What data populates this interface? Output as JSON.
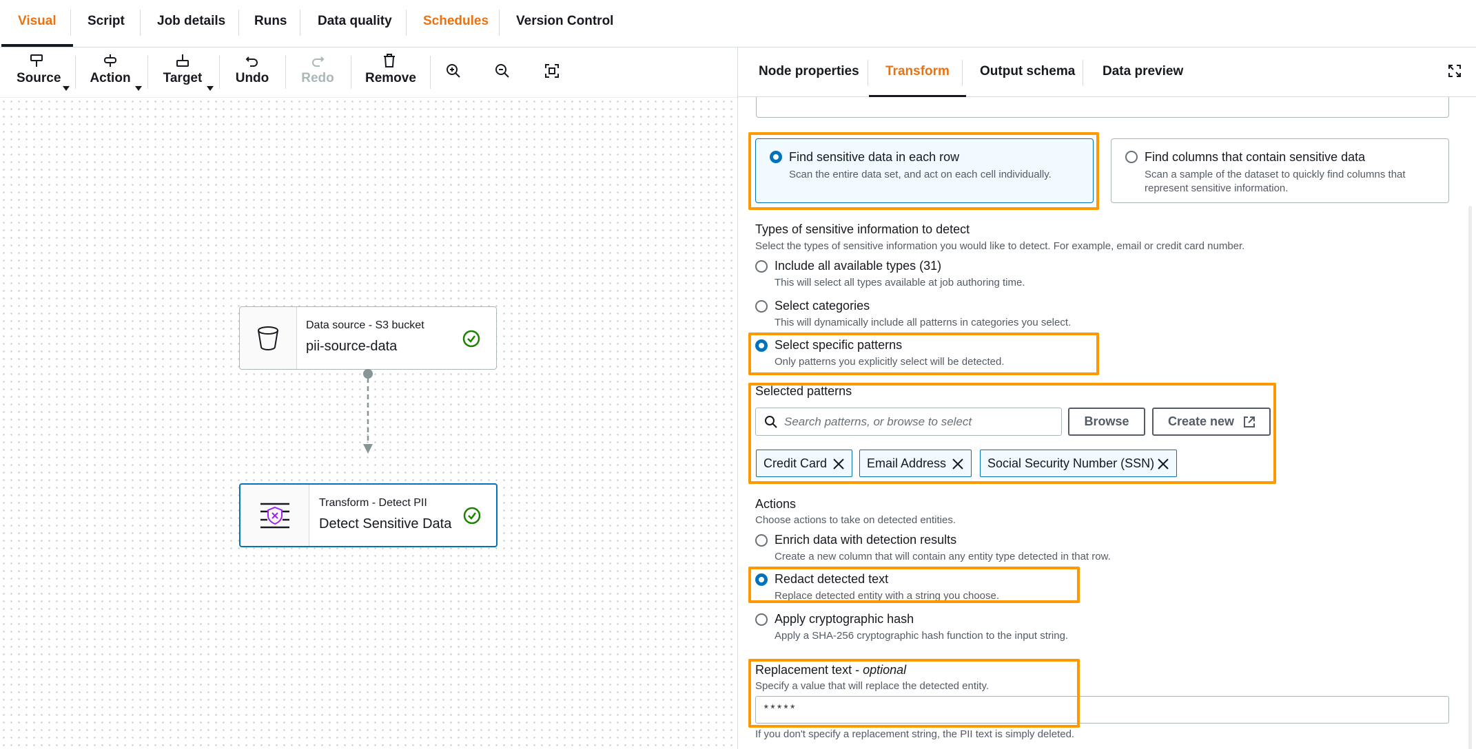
{
  "top_tabs": [
    {
      "label": "Visual"
    },
    {
      "label": "Script"
    },
    {
      "label": "Job details"
    },
    {
      "label": "Runs"
    },
    {
      "label": "Data quality"
    },
    {
      "label": "Schedules"
    },
    {
      "label": "Version Control"
    }
  ],
  "toolbar": {
    "source": "Source",
    "action": "Action",
    "target": "Target",
    "undo": "Undo",
    "redo": "Redo",
    "remove": "Remove"
  },
  "nodes": {
    "source": {
      "subtitle": "Data source - S3 bucket",
      "name": "pii-source-data"
    },
    "transform": {
      "subtitle": "Transform - Detect PII",
      "name": "Detect Sensitive Data"
    }
  },
  "panel_tabs": [
    {
      "label": "Node properties"
    },
    {
      "label": "Transform"
    },
    {
      "label": "Output schema"
    },
    {
      "label": "Data preview"
    }
  ],
  "detection_mode": {
    "row": {
      "title": "Find sensitive data in each row",
      "desc": "Scan the entire data set, and act on each cell individually."
    },
    "columns": {
      "title": "Find columns that contain sensitive data",
      "desc_line1": "Scan a sample of the dataset to quickly find columns that",
      "desc_line2": "represent sensitive information."
    }
  },
  "types": {
    "title": "Types of sensitive information to detect",
    "desc": "Select the types of sensitive information you would like to detect. For example, email or credit card number.",
    "options": [
      {
        "title": "Include all available types (31)",
        "desc": "This will select all types available at job authoring time."
      },
      {
        "title": "Select categories",
        "desc": "This will dynamically include all patterns in categories you select."
      },
      {
        "title": "Select specific patterns",
        "desc": "Only patterns you explicitly select will be detected."
      }
    ]
  },
  "patterns": {
    "title": "Selected patterns",
    "search_placeholder": "Search patterns, or browse to select",
    "browse": "Browse",
    "create_new": "Create new",
    "tokens": [
      "Credit Card",
      "Email Address",
      "Social Security Number (SSN)"
    ]
  },
  "actions": {
    "title": "Actions",
    "desc": "Choose actions to take on detected entities.",
    "options": [
      {
        "title": "Enrich data with detection results",
        "desc": "Create a new column that will contain any entity type detected in that row."
      },
      {
        "title": "Redact detected text",
        "desc": "Replace detected entity with a string you choose."
      },
      {
        "title": "Apply cryptographic hash",
        "desc": "Apply a SHA-256 cryptographic hash function to the input string."
      }
    ]
  },
  "replacement": {
    "title": "Replacement text - ",
    "optional": "optional",
    "desc": "Specify a value that will replace the detected entity.",
    "value": "*****",
    "footer": "If you don't specify a replacement string, the PII text is simply deleted."
  },
  "colors": {
    "accent": "#ec7211",
    "highlight": "#ff9900",
    "selected_blue": "#0073bb",
    "success_green": "#1d8102"
  }
}
